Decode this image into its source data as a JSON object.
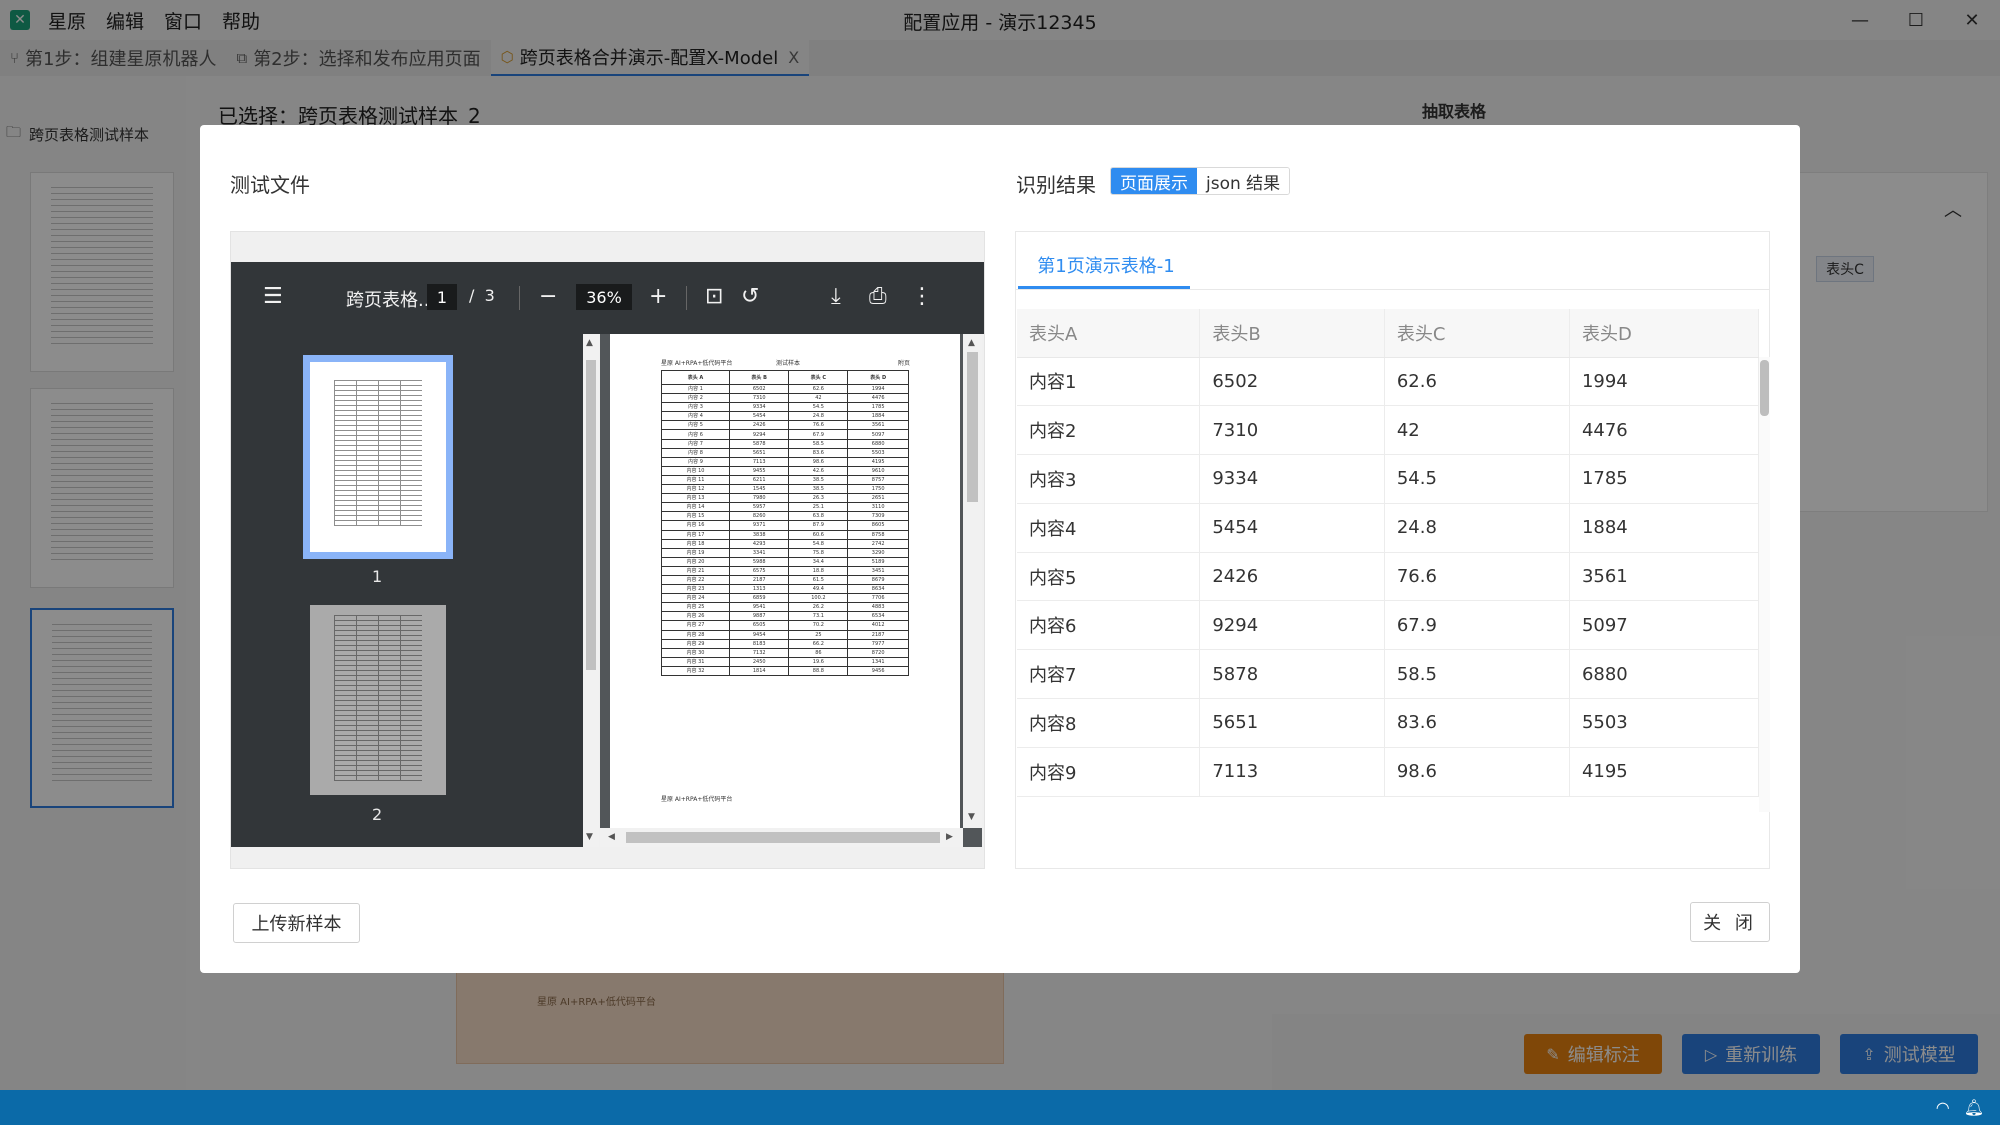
{
  "window": {
    "title": "配置应用 - 演示12345",
    "menu": [
      "星原",
      "编辑",
      "窗口",
      "帮助"
    ],
    "controls": {
      "minimize": "—",
      "maximize": "☐",
      "close": "✕"
    }
  },
  "tabs": [
    {
      "label": "第1步：组建星原机器人",
      "icon": "branch-icon"
    },
    {
      "label": "第2步：选择和发布应用页面",
      "icon": "window-icon"
    },
    {
      "label": "跨页表格合并演示-配置X-Model",
      "icon": "cube-icon",
      "active": true,
      "close": "X"
    }
  ],
  "background": {
    "folder_label": "跨页表格测试样本",
    "selected_label": "已选择：跨页表格测试样本_2",
    "extract_label": "抽取表格",
    "chip_label": "表头C",
    "footer_brand": "星原 AI+RPA+低代码平台",
    "buttons": {
      "edit": "编辑标注",
      "retrain": "重新训练",
      "test": "测试模型"
    }
  },
  "modal": {
    "test_file_title": "测试文件",
    "result_title": "识别结果",
    "segments": [
      "页面展示",
      "json 结果"
    ],
    "active_segment": "页面展示",
    "pdf": {
      "name": "跨页表格...",
      "page": "1",
      "total": "3",
      "page_sep": "/",
      "zoom": "36%",
      "thumb_labels": [
        "1",
        "2"
      ],
      "header_left": "星原 AI+RPA+低代码平台",
      "header_mid": "测试样本",
      "header_right": "附页",
      "footer": "星原 AI+RPA+低代码平台",
      "table_headers": [
        "表头 A",
        "表头 B",
        "表头 C",
        "表头 D"
      ],
      "rows": [
        [
          "内容 1",
          "6502",
          "62.6",
          "1994"
        ],
        [
          "内容 2",
          "7310",
          "42",
          "4476"
        ],
        [
          "内容 3",
          "9334",
          "54.5",
          "1785"
        ],
        [
          "内容 4",
          "5454",
          "24.8",
          "1884"
        ],
        [
          "内容 5",
          "2426",
          "76.6",
          "3561"
        ],
        [
          "内容 6",
          "9294",
          "67.9",
          "5097"
        ],
        [
          "内容 7",
          "5878",
          "58.5",
          "6880"
        ],
        [
          "内容 8",
          "5651",
          "83.6",
          "5503"
        ],
        [
          "内容 9",
          "7113",
          "98.6",
          "4195"
        ],
        [
          "内容 10",
          "9455",
          "42.6",
          "9610"
        ],
        [
          "内容 11",
          "6211",
          "38.5",
          "8757"
        ],
        [
          "内容 12",
          "1545",
          "38.5",
          "1750"
        ],
        [
          "内容 13",
          "7980",
          "26.3",
          "2651"
        ],
        [
          "内容 14",
          "5957",
          "25.1",
          "3110"
        ],
        [
          "内容 15",
          "8260",
          "63.8",
          "7309"
        ],
        [
          "内容 16",
          "9371",
          "87.9",
          "8605"
        ],
        [
          "内容 17",
          "3838",
          "60.6",
          "8758"
        ],
        [
          "内容 18",
          "4293",
          "54.8",
          "2742"
        ],
        [
          "内容 19",
          "3341",
          "75.8",
          "3290"
        ],
        [
          "内容 20",
          "5988",
          "34.4",
          "5189"
        ],
        [
          "内容 21",
          "6575",
          "18.8",
          "3451"
        ],
        [
          "内容 22",
          "2187",
          "61.5",
          "8679"
        ],
        [
          "内容 23",
          "1313",
          "49.4",
          "8634"
        ],
        [
          "内容 24",
          "6859",
          "100.2",
          "7706"
        ],
        [
          "内容 25",
          "9541",
          "26.2",
          "4883"
        ],
        [
          "内容 26",
          "9887",
          "73.1",
          "6534"
        ],
        [
          "内容 27",
          "6505",
          "70.2",
          "4012"
        ],
        [
          "内容 28",
          "9454",
          "25",
          "2187"
        ],
        [
          "内容 29",
          "8183",
          "66.2",
          "7977"
        ],
        [
          "内容 30",
          "7132",
          "86",
          "8720"
        ],
        [
          "内容 31",
          "2450",
          "19.6",
          "1341"
        ],
        [
          "内容 32",
          "1814",
          "88.8",
          "9456"
        ]
      ]
    },
    "result": {
      "tab_label": "第1页演示表格-1",
      "headers": [
        "表头A",
        "表头B",
        "表头C",
        "表头D"
      ],
      "rows": [
        [
          "内容1",
          "6502",
          "62.6",
          "1994"
        ],
        [
          "内容2",
          "7310",
          "42",
          "4476"
        ],
        [
          "内容3",
          "9334",
          "54.5",
          "1785"
        ],
        [
          "内容4",
          "5454",
          "24.8",
          "1884"
        ],
        [
          "内容5",
          "2426",
          "76.6",
          "3561"
        ],
        [
          "内容6",
          "9294",
          "67.9",
          "5097"
        ],
        [
          "内容7",
          "5878",
          "58.5",
          "6880"
        ],
        [
          "内容8",
          "5651",
          "83.6",
          "5503"
        ],
        [
          "内容9",
          "7113",
          "98.6",
          "4195"
        ]
      ]
    },
    "upload_button": "上传新样本",
    "close_button": "关 闭"
  },
  "colors": {
    "accent": "#2f8cf0",
    "orange": "#e8820f",
    "statusbar": "#0b6aa8"
  }
}
